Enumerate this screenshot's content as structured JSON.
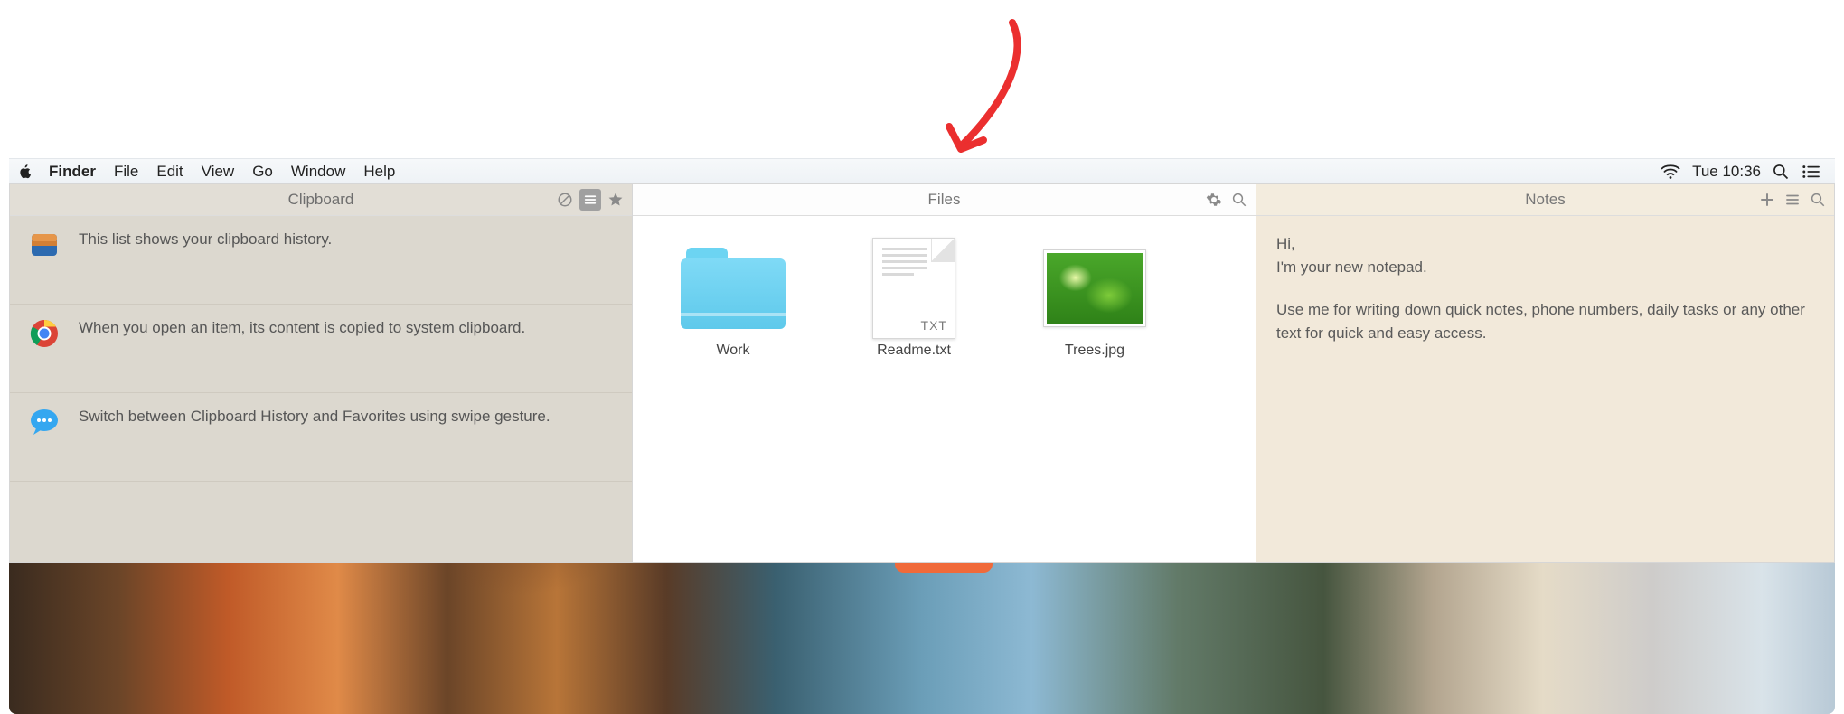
{
  "menubar": {
    "app_name": "Finder",
    "items": [
      "File",
      "Edit",
      "View",
      "Go",
      "Window",
      "Help"
    ],
    "clock": "Tue 10:36"
  },
  "clipboard": {
    "title": "Clipboard",
    "entries": [
      {
        "text": "This list shows your clipboard history."
      },
      {
        "text": "When you open an item, its content is copied to system clipboard."
      },
      {
        "text": "Switch between Clipboard History and Favorites using swipe gesture."
      }
    ]
  },
  "files": {
    "title": "Files",
    "items": [
      {
        "type": "folder",
        "label": "Work"
      },
      {
        "type": "txt",
        "label": "Readme.txt",
        "badge": "TXT"
      },
      {
        "type": "image",
        "label": "Trees.jpg"
      }
    ]
  },
  "notes": {
    "title": "Notes",
    "lines": [
      "Hi,",
      "I'm your new notepad.",
      "Use me for writing down quick notes, phone numbers, daily tasks or any other text for quick and easy access."
    ]
  }
}
